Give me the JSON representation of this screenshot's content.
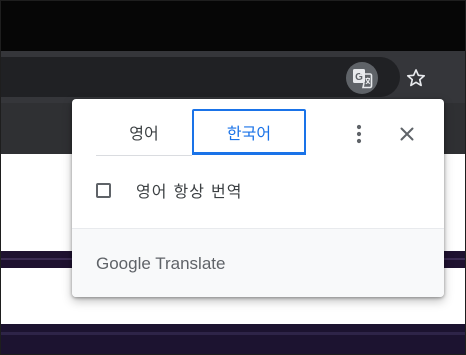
{
  "translate_popup": {
    "source_language_tab": "영어",
    "target_language_tab": "한국어",
    "always_translate_label": "영어 항상 번역",
    "always_translate_checked": false,
    "footer_brand": "Google Translate"
  },
  "toolbar": {
    "translate_icon": "google-translate-icon",
    "bookmark_icon": "star-outline-icon"
  },
  "colors": {
    "accent": "#1a73e8",
    "toolbar_bg": "#35363a",
    "omnibox_bg": "#202124",
    "footer_bg": "#f8f9fa"
  }
}
